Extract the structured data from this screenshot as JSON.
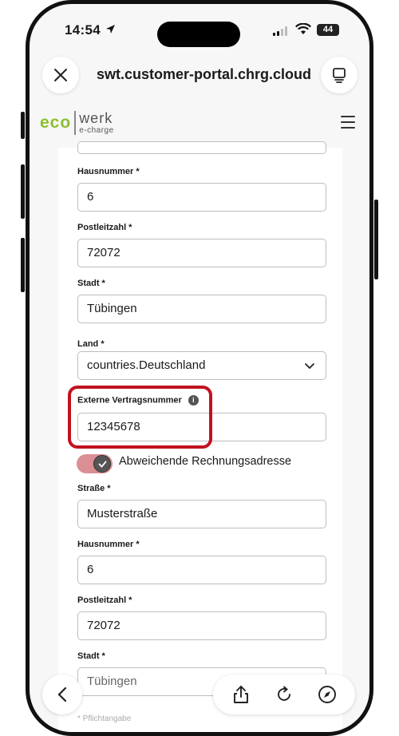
{
  "status_bar": {
    "time": "14:54",
    "battery": "44"
  },
  "browser": {
    "url": "swt.customer-portal.chrg.cloud"
  },
  "header": {
    "logo_eco": "eco",
    "logo_werk": "werk",
    "logo_sub": "e-charge"
  },
  "form": {
    "house_number_label": "Hausnummer *",
    "house_number_value": "6",
    "postal_code_label": "Postleitzahl *",
    "postal_code_value": "72072",
    "city_label": "Stadt *",
    "city_value": "Tübingen",
    "country_label": "Land *",
    "country_value": "countries.Deutschland",
    "external_contract_label": "Externe Vertragsnummer",
    "external_contract_value": "12345678",
    "billing_toggle_label": "Abweichende Rechnungsadresse",
    "billing_street_label": "Straße *",
    "billing_street_value": "Musterstraße",
    "billing_house_number_label": "Hausnummer *",
    "billing_house_number_value": "6",
    "billing_postal_code_label": "Postleitzahl *",
    "billing_postal_code_value": "72072",
    "billing_city_label": "Stadt *",
    "billing_city_value": "Tübingen",
    "required_note": "* Pflichtangabe"
  },
  "colors": {
    "brand_green": "#8bbf2f",
    "highlight_red": "#c1121f",
    "toggle_track": "#d98f93"
  }
}
